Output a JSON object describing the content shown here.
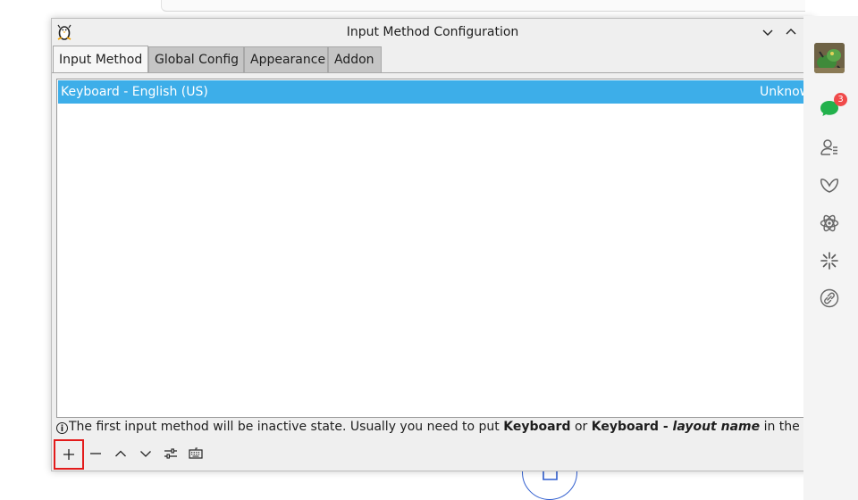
{
  "window": {
    "title": "Input Method Configuration"
  },
  "tabs": [
    {
      "label": "Input Method",
      "active": true
    },
    {
      "label": "Global Config",
      "active": false
    },
    {
      "label": "Appearance",
      "active": false
    },
    {
      "label": "Addon",
      "active": false
    }
  ],
  "input_methods": [
    {
      "name": "Keyboard - English (US)",
      "language": "Unknown",
      "selected": true
    }
  ],
  "hint": {
    "prefix": "The first input method will be inactive state. Usually you need to put ",
    "bold1": "Keyboard",
    "mid": " or ",
    "bold2": "Keyboard - ",
    "italic": "layout name",
    "suffix": " in the first place."
  },
  "toolbar": {
    "buttons": [
      "add-icon",
      "remove-icon",
      "move-up-icon",
      "move-down-icon",
      "configure-icon",
      "keyboard-layout-icon"
    ]
  },
  "dock": {
    "unread_count": "3",
    "icons": [
      "avatar",
      "chat-icon",
      "contacts-icon",
      "butterfly-icon",
      "atom-icon",
      "sparkle-icon",
      "link-icon"
    ]
  },
  "colors": {
    "selection": "#3daee9",
    "badge": "#f04a4a",
    "chat": "#22b14c",
    "focus": "#e31b1b"
  }
}
